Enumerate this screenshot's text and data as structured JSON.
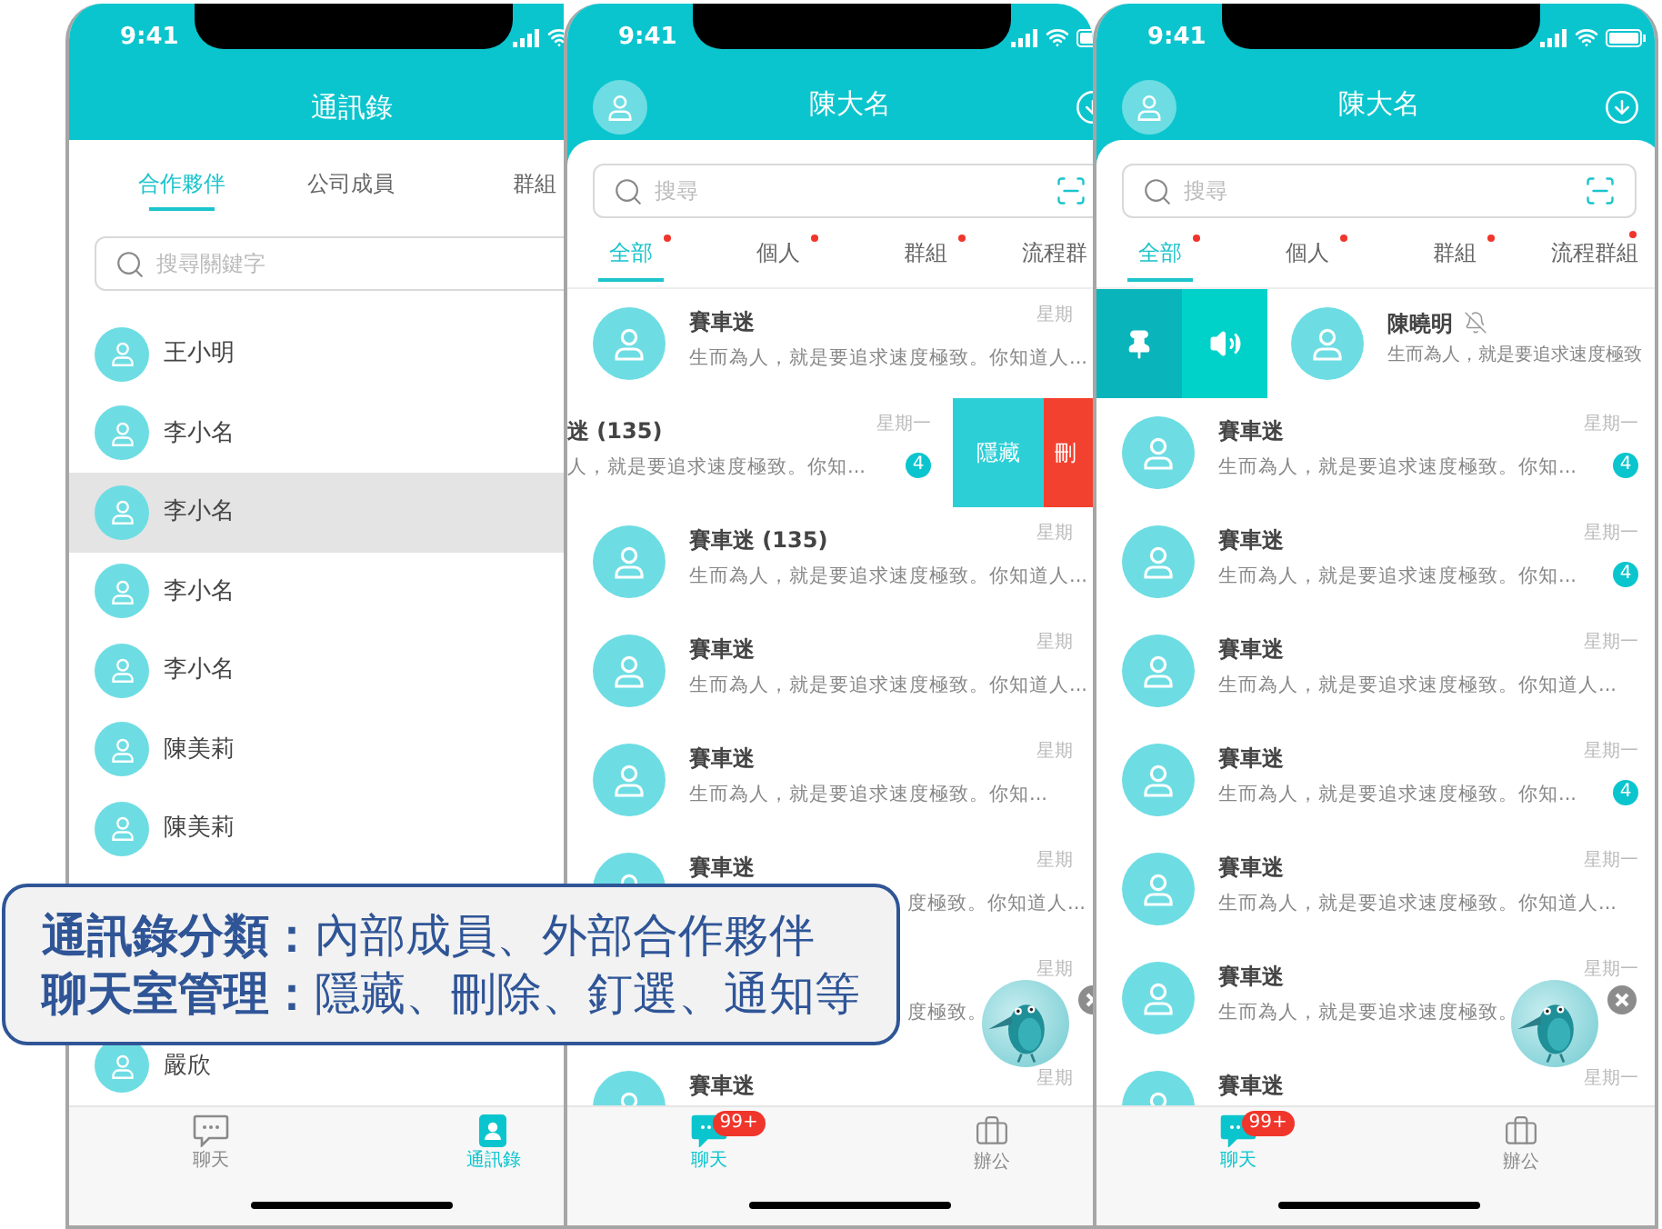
{
  "contacts_screen": {
    "time": "9:41",
    "title": "通訊錄",
    "tabs": [
      {
        "label": "合作夥伴",
        "selected": true
      },
      {
        "label": "公司成員",
        "selected": false
      },
      {
        "label": "群組",
        "selected": false
      }
    ],
    "search": {
      "placeholder": "搜尋關鍵字"
    },
    "contacts": [
      {
        "name": "王小明",
        "selected": false
      },
      {
        "name": "李小名",
        "selected": false
      },
      {
        "name": "李小名",
        "selected": true
      },
      {
        "name": "李小名",
        "selected": false
      },
      {
        "name": "李小名",
        "selected": false
      },
      {
        "name": "陳美莉",
        "selected": false
      },
      {
        "name": "陳美莉",
        "selected": false
      },
      {
        "name": "嚴欣",
        "selected": false
      }
    ],
    "bottom_tabs": [
      {
        "kind": "chat",
        "label": "聊天",
        "selected": false
      },
      {
        "kind": "contacts",
        "label": "通訊錄",
        "selected": true
      }
    ]
  },
  "chat_screens": [
    {
      "time": "9:41",
      "title": "陳大名",
      "search": {
        "placeholder": "搜尋"
      },
      "tabs": [
        {
          "label": "全部",
          "selected": true,
          "unread": true
        },
        {
          "label": "個人",
          "selected": false,
          "unread": true
        },
        {
          "label": "群組",
          "selected": false,
          "unread": true
        },
        {
          "label": "流程群",
          "selected": false,
          "unread": false
        }
      ],
      "rows": [
        {
          "kind": "normal",
          "name": "賽車迷",
          "message": "生而為人，就是要追求速度極致。你知道人...",
          "time": "星期"
        },
        {
          "kind": "swiped-left",
          "name": "迷 (135)",
          "message": "人，就是要追求速度極致。你知...",
          "time": "星期一",
          "badge": "4",
          "actions": [
            {
              "kind": "hide",
              "label": "隱藏"
            },
            {
              "kind": "delete",
              "label": "刪"
            }
          ]
        },
        {
          "kind": "normal",
          "name": "賽車迷 (135)",
          "message": "生而為人，就是要追求速度極致。你知道人...",
          "time": "星期"
        },
        {
          "kind": "normal",
          "name": "賽車迷",
          "message": "生而為人，就是要追求速度極致。你知道人...",
          "time": "星期"
        },
        {
          "kind": "normal",
          "name": "賽車迷",
          "message": "生而為人，就是要追求速度極致。你知...",
          "time": "星期"
        },
        {
          "kind": "covered",
          "name": "賽車迷",
          "message": "度極致。你知道人...",
          "time": "星期"
        },
        {
          "kind": "covered",
          "message": "度極致。",
          "time": "星期"
        },
        {
          "kind": "normal",
          "name": "賽車迷",
          "time": "星期"
        }
      ],
      "bottom_tabs": [
        {
          "kind": "chat",
          "label": "聊天",
          "selected": true,
          "badge": "99+"
        },
        {
          "kind": "office",
          "label": "辦公",
          "selected": false
        }
      ]
    },
    {
      "time": "9:41",
      "title": "陳大名",
      "search": {
        "placeholder": "搜尋"
      },
      "tabs": [
        {
          "label": "全部",
          "selected": true,
          "unread": true
        },
        {
          "label": "個人",
          "selected": false,
          "unread": true
        },
        {
          "label": "群組",
          "selected": false,
          "unread": true
        },
        {
          "label": "流程群組",
          "selected": false,
          "unread": true
        }
      ],
      "rows": [
        {
          "kind": "swiped-right",
          "name": "陳曉明",
          "muted": true,
          "message": "生而為人，就是要追求速度極致",
          "actions": [
            {
              "kind": "pin"
            },
            {
              "kind": "sound"
            }
          ]
        },
        {
          "kind": "normal",
          "name": "賽車迷",
          "message": "生而為人，就是要追求速度極致。你知...",
          "time": "星期一",
          "badge": "4"
        },
        {
          "kind": "normal",
          "name": "賽車迷",
          "message": "生而為人，就是要追求速度極致。你知...",
          "time": "星期一",
          "badge": "4"
        },
        {
          "kind": "normal",
          "name": "賽車迷",
          "message": "生而為人，就是要追求速度極致。你知道人...",
          "time": "星期一"
        },
        {
          "kind": "normal",
          "name": "賽車迷",
          "message": "生而為人，就是要追求速度極致。你知...",
          "time": "星期一",
          "badge": "4"
        },
        {
          "kind": "normal",
          "name": "賽車迷",
          "message": "生而為人，就是要追求速度極致。你知道人...",
          "time": "星期一"
        },
        {
          "kind": "normal",
          "name": "賽車迷",
          "message": "生而為人，就是要追求速度極致。",
          "time": "星期一"
        },
        {
          "kind": "normal",
          "name": "賽車迷",
          "time": "星期一"
        }
      ],
      "bottom_tabs": [
        {
          "kind": "chat",
          "label": "聊天",
          "selected": true,
          "badge": "99+"
        },
        {
          "kind": "office",
          "label": "辦公",
          "selected": false
        }
      ]
    }
  ],
  "callout": {
    "lines": [
      "**通訊錄分類：**內部成員、外部合作夥伴",
      "**聊天室管理：**隱藏、刪除、釘選、通知等"
    ]
  }
}
